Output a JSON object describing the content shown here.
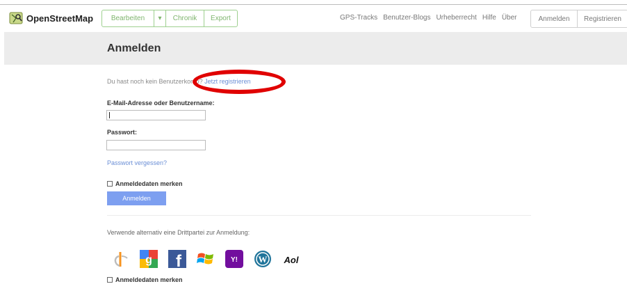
{
  "header": {
    "logo_text": "OpenStreetMap",
    "edit_group": [
      {
        "label": "Bearbeiten"
      },
      {
        "label": "▾"
      },
      {
        "label": "Chronik"
      },
      {
        "label": "Export"
      }
    ],
    "nav_links": [
      "GPS-Tracks",
      "Benutzer-Blogs",
      "Urheberrecht",
      "Hilfe",
      "Über"
    ],
    "auth_buttons": [
      {
        "label": "Anmelden"
      },
      {
        "label": "Registrieren"
      }
    ]
  },
  "page": {
    "title": "Anmelden",
    "no_account_text": "Du hast noch kein Benutzerkonto?",
    "register_link": "Jetzt registrieren",
    "username_label": "E-Mail-Adresse oder Benutzername:",
    "username_value": "",
    "password_label": "Passwort:",
    "password_value": "",
    "forgot_link": "Passwort vergessen?",
    "remember_label": "Anmeldedaten merken",
    "submit_label": "Anmelden",
    "third_party_text": "Verwende alternativ eine Drittpartei zur Anmeldung:",
    "remember_label_2": "Anmeldedaten merken"
  },
  "providers": [
    {
      "icon": "openid-icon",
      "color": "#f7931e"
    },
    {
      "icon": "google-icon",
      "color": "#4285f4"
    },
    {
      "icon": "facebook-icon",
      "color": "#3b5998"
    },
    {
      "icon": "windows-live-icon",
      "color": "#f25022"
    },
    {
      "icon": "yahoo-icon",
      "color": "#720e9e"
    },
    {
      "icon": "wordpress-icon",
      "color": "#21759b"
    },
    {
      "icon": "aol-icon",
      "color": "#000000"
    }
  ],
  "colors": {
    "brand_green": "#7fb56e",
    "link_blue": "#6b8fd6",
    "submit_blue": "#7d9ff0",
    "highlight_red": "#e00000"
  }
}
